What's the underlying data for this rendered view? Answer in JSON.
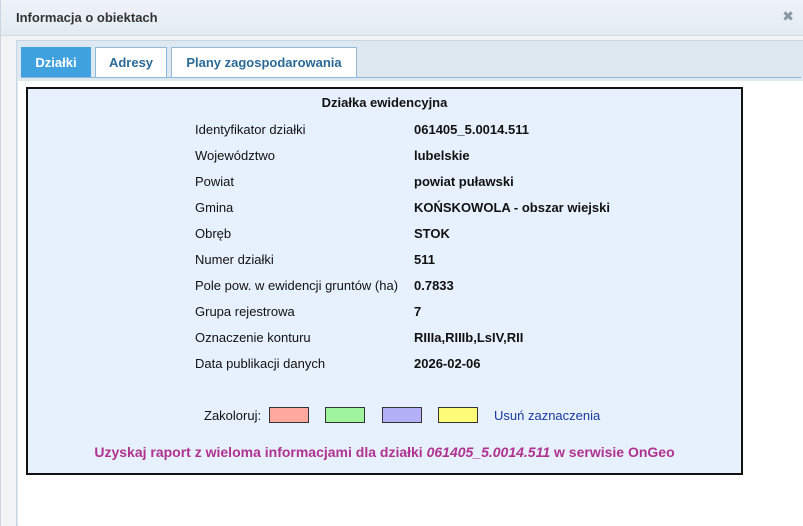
{
  "window": {
    "title": "Informacja o obiektach",
    "close_icon": "close-icon"
  },
  "tabs": [
    {
      "label": "Działki",
      "active": true
    },
    {
      "label": "Adresy",
      "active": false
    },
    {
      "label": "Plany zagospodarowania",
      "active": false
    }
  ],
  "section": {
    "heading": "Działka ewidencyjna"
  },
  "rows": [
    {
      "label": "Identyfikator działki",
      "value": "061405_5.0014.511"
    },
    {
      "label": "Województwo",
      "value": "lubelskie"
    },
    {
      "label": "Powiat",
      "value": "powiat puławski"
    },
    {
      "label": "Gmina",
      "value": "KOŃSKOWOLA - obszar wiejski"
    },
    {
      "label": "Obręb",
      "value": "STOK"
    },
    {
      "label": "Numer działki",
      "value": "511"
    },
    {
      "label": "Pole pow. w ewidencji gruntów (ha)",
      "value": "0.7833"
    },
    {
      "label": "Grupa rejestrowa",
      "value": "7"
    },
    {
      "label": "Oznaczenie konturu",
      "value": "RIIIa,RIIIb,LsIV,RII"
    },
    {
      "label": "Data publikacji danych",
      "value": "2026-02-06"
    }
  ],
  "colorize": {
    "label": "Zakoloruj:",
    "colors": [
      "#ffa8a0",
      "#9ef59e",
      "#b3b0f7",
      "#fdfb78"
    ],
    "clear_label": "Usuń zaznaczenia"
  },
  "report": {
    "prefix": "Uzyskaj raport z wieloma informacjami dla działki ",
    "parcel_id": "061405_5.0014.511",
    "suffix": " w serwisie OnGeo"
  }
}
